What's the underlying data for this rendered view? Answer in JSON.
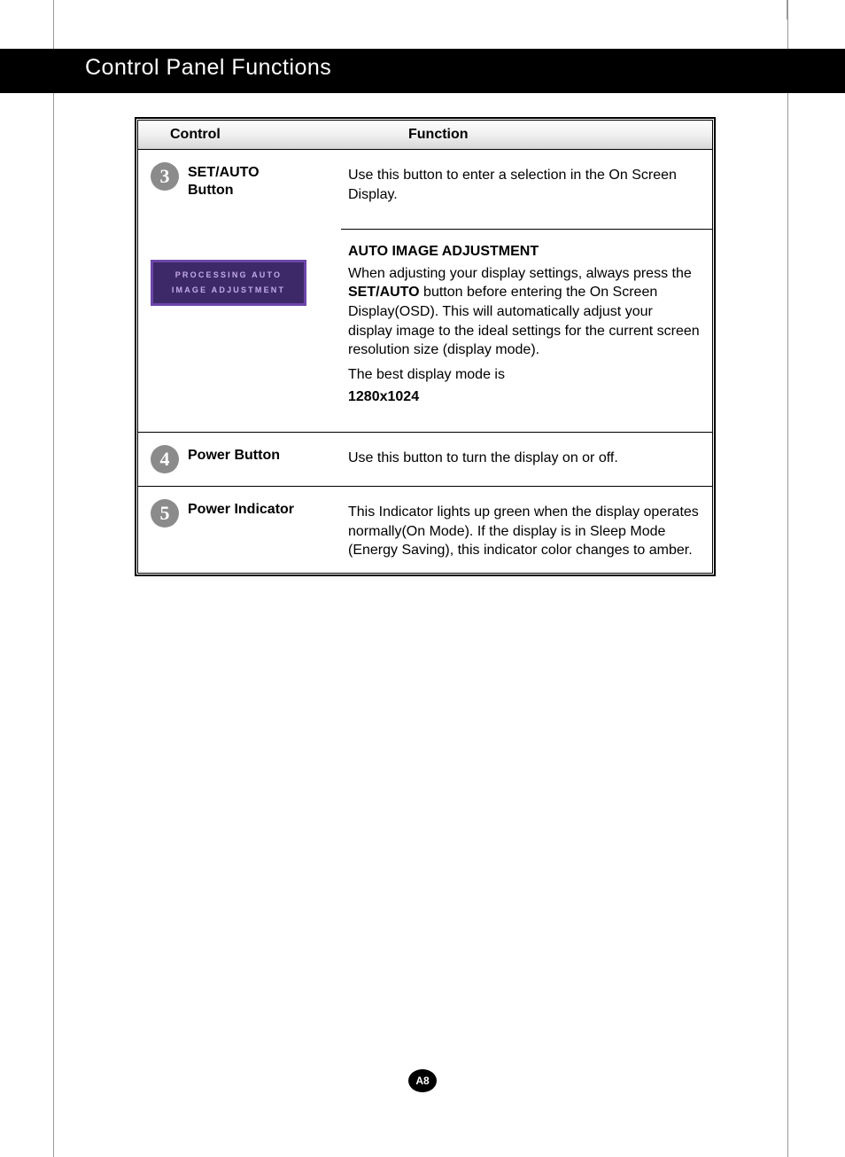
{
  "header": {
    "title": "Control Panel Functions"
  },
  "table": {
    "headers": {
      "control": "Control",
      "function": "Function"
    },
    "rows": [
      {
        "num": "3",
        "control_label": "SET/AUTO\nButton",
        "function_text": "Use this button to enter a selection in the On Screen Display.",
        "osd_line1": "PROCESSING AUTO",
        "osd_line2": "IMAGE ADJUSTMENT",
        "sub": {
          "heading": "AUTO IMAGE ADJUSTMENT",
          "body_before": "When adjusting your display settings, always press the ",
          "body_bold": "SET/AUTO",
          "body_after": " button before entering the On Screen Display(OSD). This will automatically adjust your display image to the ideal settings for the current screen resolution size (display mode).",
          "best_mode": "The best display mode is",
          "resolution": "1280x1024"
        }
      },
      {
        "num": "4",
        "control_label": "Power Button",
        "function_text": "Use this button to turn the display on or off."
      },
      {
        "num": "5",
        "control_label": "Power Indicator",
        "function_text": "This Indicator lights up green when the display operates normally(On Mode). If the display is in Sleep Mode (Energy Saving), this indicator color changes to amber."
      }
    ]
  },
  "page_number": "A8"
}
